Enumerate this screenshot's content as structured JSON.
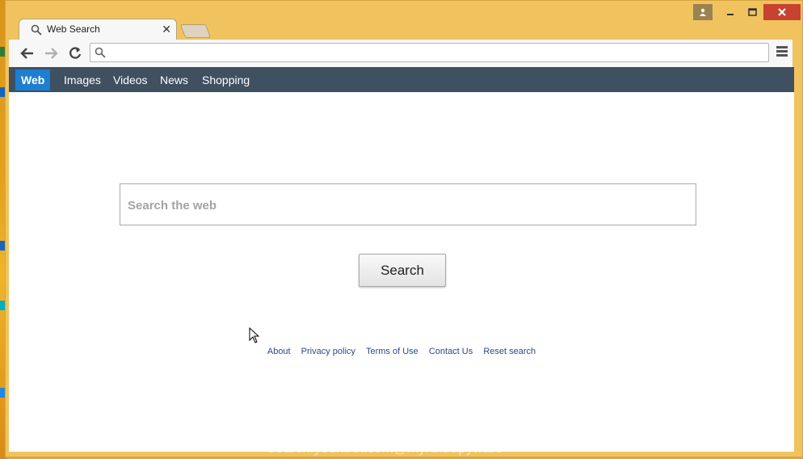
{
  "tab": {
    "title": "Web Search",
    "icon": "search-icon",
    "close_glyph": "✕"
  },
  "window_controls": {
    "user_icon": "user-icon",
    "min_icon": "minimize-icon",
    "max_icon": "maximize-icon",
    "close_icon": "close-icon"
  },
  "toolbar": {
    "back_icon": "back-arrow-icon",
    "forward_icon": "forward-arrow-icon",
    "reload_icon": "reload-icon",
    "omnibox_value": "",
    "menu_icon": "hamburger-menu-icon"
  },
  "nav": {
    "items": [
      "Web",
      "Images",
      "Videos",
      "News",
      "Shopping"
    ],
    "active": "Web"
  },
  "search": {
    "placeholder": "Search the web",
    "button_label": "Search"
  },
  "footer": {
    "links": [
      "About",
      "Privacy policy",
      "Terms of Use",
      "Contact Us",
      "Reset search"
    ]
  },
  "watermark": "Search.yourfirth.com@MyAntiSpyware",
  "colors": {
    "frame": "#f0c35f",
    "navbar": "#3f5060",
    "active_tab": "#1d7fd1",
    "link": "#2a4a8a",
    "close_button": "#c7432f"
  }
}
